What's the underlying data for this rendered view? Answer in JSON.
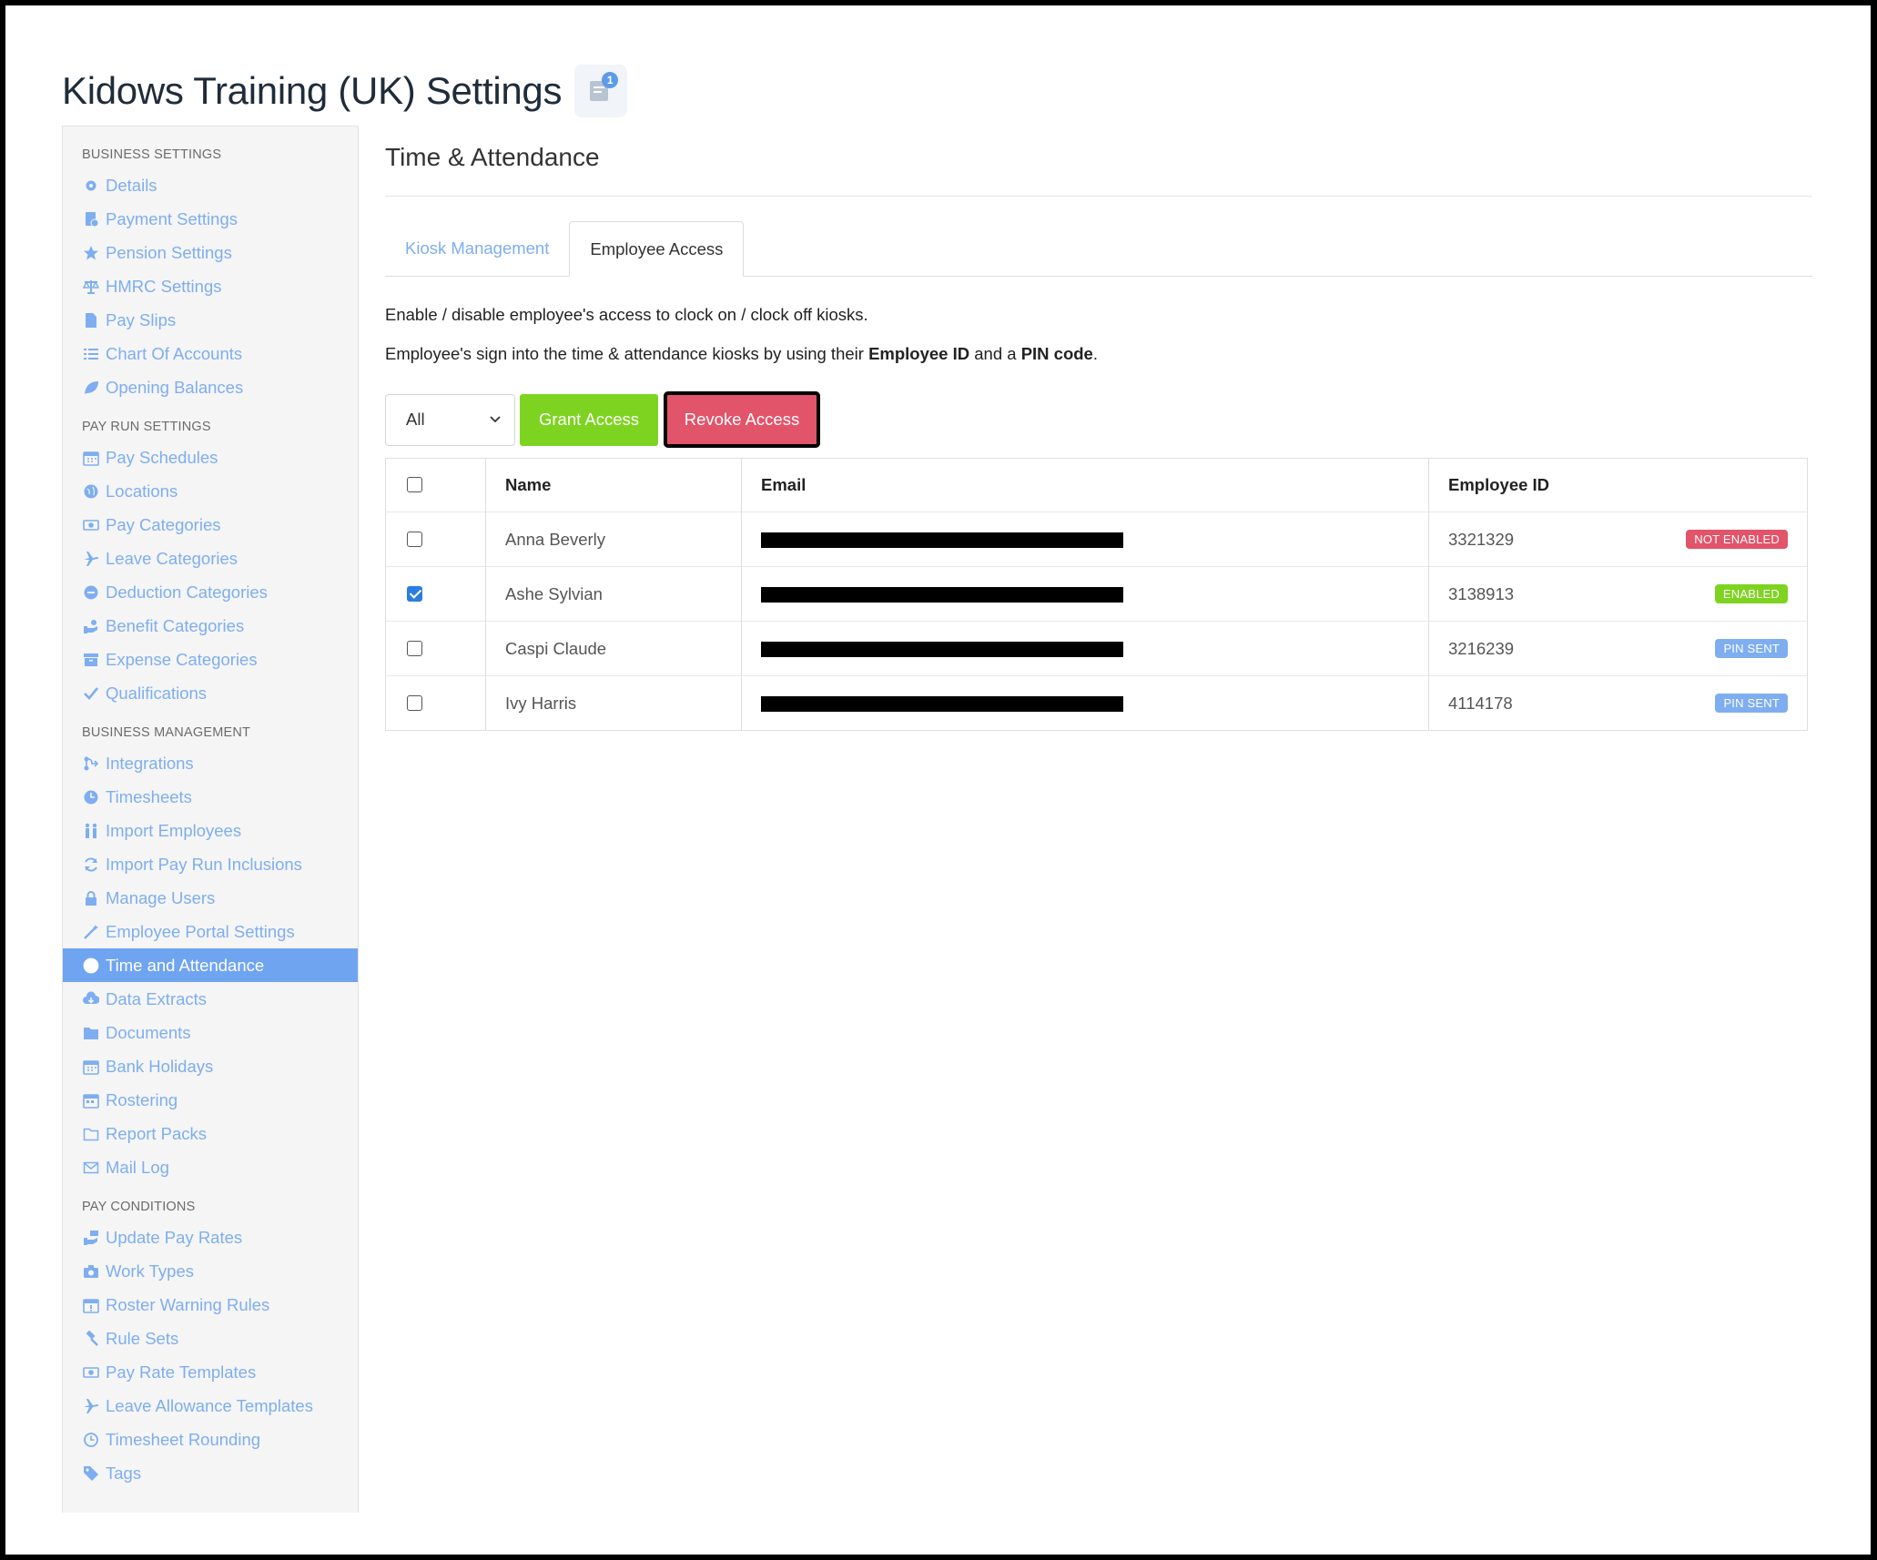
{
  "page": {
    "title": "Kidows Training (UK) Settings",
    "notes_count": "1"
  },
  "sidebar": {
    "sections": [
      {
        "heading": "BUSINESS SETTINGS",
        "items": [
          {
            "label": "Details",
            "icon": "gear-icon"
          },
          {
            "label": "Payment Settings",
            "icon": "payment-doc-icon"
          },
          {
            "label": "Pension Settings",
            "icon": "star-icon"
          },
          {
            "label": "HMRC Settings",
            "icon": "scales-icon"
          },
          {
            "label": "Pay Slips",
            "icon": "file-icon"
          },
          {
            "label": "Chart Of Accounts",
            "icon": "list-icon"
          },
          {
            "label": "Opening Balances",
            "icon": "leaf-icon"
          }
        ]
      },
      {
        "heading": "PAY RUN SETTINGS",
        "items": [
          {
            "label": "Pay Schedules",
            "icon": "calendar-icon"
          },
          {
            "label": "Locations",
            "icon": "globe-icon"
          },
          {
            "label": "Pay Categories",
            "icon": "money-icon"
          },
          {
            "label": "Leave Categories",
            "icon": "plane-icon"
          },
          {
            "label": "Deduction Categories",
            "icon": "minus-circle-icon"
          },
          {
            "label": "Benefit Categories",
            "icon": "benefit-icon"
          },
          {
            "label": "Expense Categories",
            "icon": "archive-icon"
          },
          {
            "label": "Qualifications",
            "icon": "check-icon"
          }
        ]
      },
      {
        "heading": "BUSINESS MANAGEMENT",
        "items": [
          {
            "label": "Integrations",
            "icon": "integration-icon"
          },
          {
            "label": "Timesheets",
            "icon": "clock-icon"
          },
          {
            "label": "Import Employees",
            "icon": "people-icon"
          },
          {
            "label": "Import Pay Run Inclusions",
            "icon": "refresh-icon"
          },
          {
            "label": "Manage Users",
            "icon": "lock-icon"
          },
          {
            "label": "Employee Portal Settings",
            "icon": "wand-icon"
          },
          {
            "label": "Time and Attendance",
            "icon": "user-circle-icon",
            "active": true
          },
          {
            "label": "Data Extracts",
            "icon": "cloud-download-icon"
          },
          {
            "label": "Documents",
            "icon": "folder-icon"
          },
          {
            "label": "Bank Holidays",
            "icon": "calendar-icon"
          },
          {
            "label": "Rostering",
            "icon": "calendar-grid-icon"
          },
          {
            "label": "Report Packs",
            "icon": "folder-outline-icon"
          },
          {
            "label": "Mail Log",
            "icon": "envelope-icon"
          }
        ]
      },
      {
        "heading": "PAY CONDITIONS",
        "items": [
          {
            "label": "Update Pay Rates",
            "icon": "hand-money-icon"
          },
          {
            "label": "Work Types",
            "icon": "camera-icon"
          },
          {
            "label": "Roster Warning Rules",
            "icon": "calendar-alert-icon"
          },
          {
            "label": "Rule Sets",
            "icon": "gavel-icon"
          },
          {
            "label": "Pay Rate Templates",
            "icon": "money-icon"
          },
          {
            "label": "Leave Allowance Templates",
            "icon": "plane-icon"
          },
          {
            "label": "Timesheet Rounding",
            "icon": "clock-outline-icon"
          },
          {
            "label": "Tags",
            "icon": "tag-icon"
          }
        ]
      }
    ]
  },
  "main": {
    "section_title": "Time & Attendance",
    "tabs": [
      {
        "label": "Kiosk Management",
        "active": false
      },
      {
        "label": "Employee Access",
        "active": true
      }
    ],
    "desc1": "Enable / disable employee's access to clock on / clock off kiosks.",
    "desc2_pre": "Employee's sign into the time & attendance kiosks by using their ",
    "desc2_b1": "Employee ID",
    "desc2_mid": " and a ",
    "desc2_b2": "PIN code",
    "desc2_post": ".",
    "filter_value": "All",
    "grant_label": "Grant Access",
    "revoke_label": "Revoke Access",
    "table": {
      "headers": {
        "name": "Name",
        "email": "Email",
        "employee_id": "Employee ID"
      },
      "rows": [
        {
          "name": "Anna Beverly",
          "employee_id": "3321329",
          "status": "NOT ENABLED",
          "status_color": "#e2546a",
          "checked": false
        },
        {
          "name": "Ashe Sylvian",
          "employee_id": "3138913",
          "status": "ENABLED",
          "status_color": "#7ed321",
          "checked": true
        },
        {
          "name": "Caspi Claude",
          "employee_id": "3216239",
          "status": "PIN SENT",
          "status_color": "#7eaef0",
          "checked": false
        },
        {
          "name": "Ivy Harris",
          "employee_id": "4114178",
          "status": "PIN SENT",
          "status_color": "#7eaef0",
          "checked": false
        }
      ]
    }
  },
  "colors": {
    "accent": "#6fa4f1",
    "link": "#7eaef0",
    "grant": "#7ed321",
    "revoke": "#e2546a"
  }
}
